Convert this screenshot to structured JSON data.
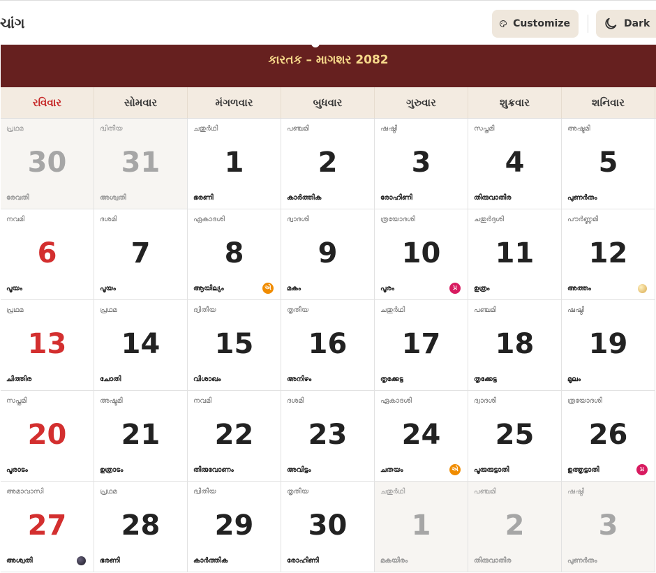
{
  "app": {
    "title": "ચાંગ",
    "customize_label": "Customize",
    "dark_label": "Dark"
  },
  "calendar": {
    "month_title": "કારતક – માગશર 2082",
    "weekdays": [
      "રવિવાર",
      "સોમવાર",
      "મંગળવાર",
      "બુધવાર",
      "ગુરુવાર",
      "શુક્રવાર",
      "શનિવાર"
    ],
    "days": [
      {
        "day": "30",
        "tithi": "പ്രഥമ",
        "nakshatra": "രേവതി",
        "outside": true
      },
      {
        "day": "31",
        "tithi": "ദ്വിതീയ",
        "nakshatra": "അശ്വതി",
        "outside": true
      },
      {
        "day": "1",
        "tithi": "ചതുർഥി",
        "nakshatra": "ഭരണി"
      },
      {
        "day": "2",
        "tithi": "പഞ്ചമി",
        "nakshatra": "കാർത്തിക"
      },
      {
        "day": "3",
        "tithi": "ഷഷ്ഠി",
        "nakshatra": "രോഹിണി"
      },
      {
        "day": "4",
        "tithi": "സപ്തമി",
        "nakshatra": "തിരുവാതിര"
      },
      {
        "day": "5",
        "tithi": "അഷ്ടമി",
        "nakshatra": "പുണർതം"
      },
      {
        "day": "6",
        "tithi": "നവമി",
        "nakshatra": "പൂയം"
      },
      {
        "day": "7",
        "tithi": "ദശമി",
        "nakshatra": "പൂയം"
      },
      {
        "day": "8",
        "tithi": "ഏകാദശി",
        "nakshatra": "ആയില്യം",
        "badge": "એ",
        "badge_color": "orange"
      },
      {
        "day": "9",
        "tithi": "ദ്വാദശി",
        "nakshatra": "മകം"
      },
      {
        "day": "10",
        "tithi": "ത്രയോദശി",
        "nakshatra": "പൂരം",
        "badge": "પ્ર",
        "badge_color": "pink"
      },
      {
        "day": "11",
        "tithi": "ചതുർദ്ദശി",
        "nakshatra": "ഉത്രം"
      },
      {
        "day": "12",
        "tithi": "പൗർണ്ണമി",
        "nakshatra": "അത്തം",
        "moon": "full"
      },
      {
        "day": "13",
        "tithi": "പ്രഥമ",
        "nakshatra": "ചിത്തിര"
      },
      {
        "day": "14",
        "tithi": "പ്രഥമ",
        "nakshatra": "ചോതി"
      },
      {
        "day": "15",
        "tithi": "ദ്വിതീയ",
        "nakshatra": "വിശാഖം"
      },
      {
        "day": "16",
        "tithi": "തൃതീയ",
        "nakshatra": "അനിഴം"
      },
      {
        "day": "17",
        "tithi": "ചതുർഥി",
        "nakshatra": "തൃക്കേട്ട"
      },
      {
        "day": "18",
        "tithi": "പഞ്ചമി",
        "nakshatra": "തൃക്കേട്ട"
      },
      {
        "day": "19",
        "tithi": "ഷഷ്ഠി",
        "nakshatra": "മൂലം"
      },
      {
        "day": "20",
        "tithi": "സപ്തമി",
        "nakshatra": "പൂരാടം"
      },
      {
        "day": "21",
        "tithi": "അഷ്ടമി",
        "nakshatra": "ഉത്രാടം"
      },
      {
        "day": "22",
        "tithi": "നവമി",
        "nakshatra": "തിരുവോണം"
      },
      {
        "day": "23",
        "tithi": "ദശമി",
        "nakshatra": "അവിട്ടം"
      },
      {
        "day": "24",
        "tithi": "ഏകാദശി",
        "nakshatra": "ചതയം",
        "badge": "એ",
        "badge_color": "orange"
      },
      {
        "day": "25",
        "tithi": "ദ്വാദശി",
        "nakshatra": "പൂരുരുട്ടാതി"
      },
      {
        "day": "26",
        "tithi": "ത്രയോദശി",
        "nakshatra": "ഉത്തൃട്ടാതി",
        "badge": "પ્ર",
        "badge_color": "pink"
      },
      {
        "day": "27",
        "tithi": "അമാവാസി",
        "nakshatra": "അശ്വതി",
        "moon": "new"
      },
      {
        "day": "28",
        "tithi": "പ്രഥമ",
        "nakshatra": "ഭരണി"
      },
      {
        "day": "29",
        "tithi": "ദ്വിതീയ",
        "nakshatra": "കാർത്തിക"
      },
      {
        "day": "30",
        "tithi": "തൃതീയ",
        "nakshatra": "രോഹിണി"
      },
      {
        "day": "1",
        "tithi": "ചതുർഥി",
        "nakshatra": "മകയിരം",
        "outside": true
      },
      {
        "day": "2",
        "tithi": "പഞ്ചമി",
        "nakshatra": "തിരുവാതിര",
        "outside": true
      },
      {
        "day": "3",
        "tithi": "ഷഷ്ഠി",
        "nakshatra": "പുണർതം",
        "outside": true
      }
    ]
  }
}
